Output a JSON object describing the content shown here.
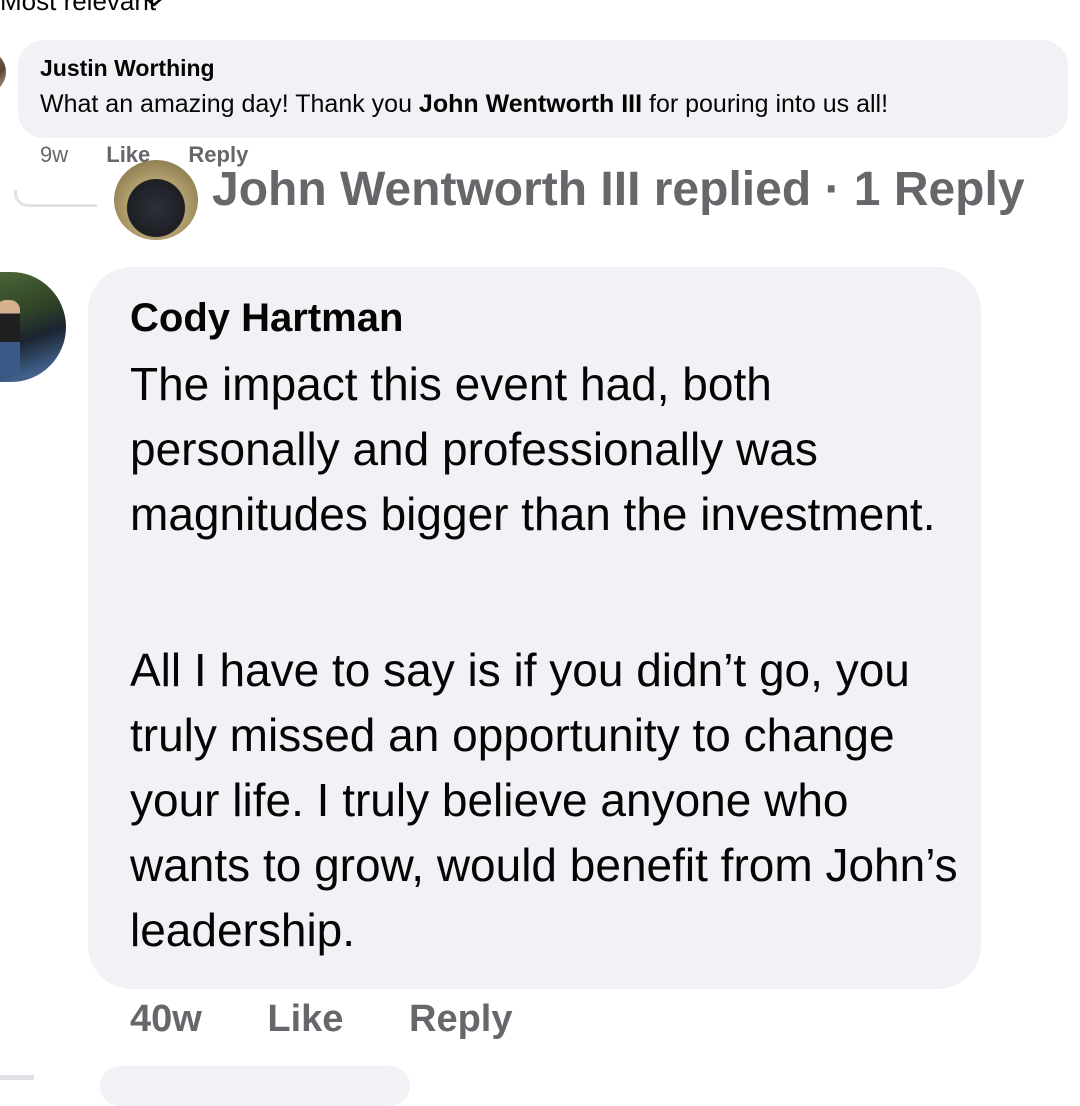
{
  "sort": {
    "label": "Most relevant"
  },
  "comments": [
    {
      "author": "Justin Worthing",
      "text_before": "What an amazing day! Thank you ",
      "mention": "John Wentworth III",
      "text_after": " for pouring into us all!",
      "time": "9w",
      "like_label": "Like",
      "reply_label": "Reply"
    },
    {
      "author": "Cody Hartman",
      "paragraphs": [
        "The impact this event had, both personally and professionally was magnitudes bigger than the investment.",
        "All I have to say is if you didn’t go, you truly missed an opportunity to change your life. I truly believe anyone who wants to grow, would benefit from John’s leadership."
      ],
      "time": "40w",
      "like_label": "Like",
      "reply_label": "Reply"
    }
  ],
  "replied_row": {
    "text": "John Wentworth III replied · 1 Reply"
  },
  "colors": {
    "bubble": "#f0f2f5",
    "meta": "#65676b",
    "text": "#050505"
  }
}
